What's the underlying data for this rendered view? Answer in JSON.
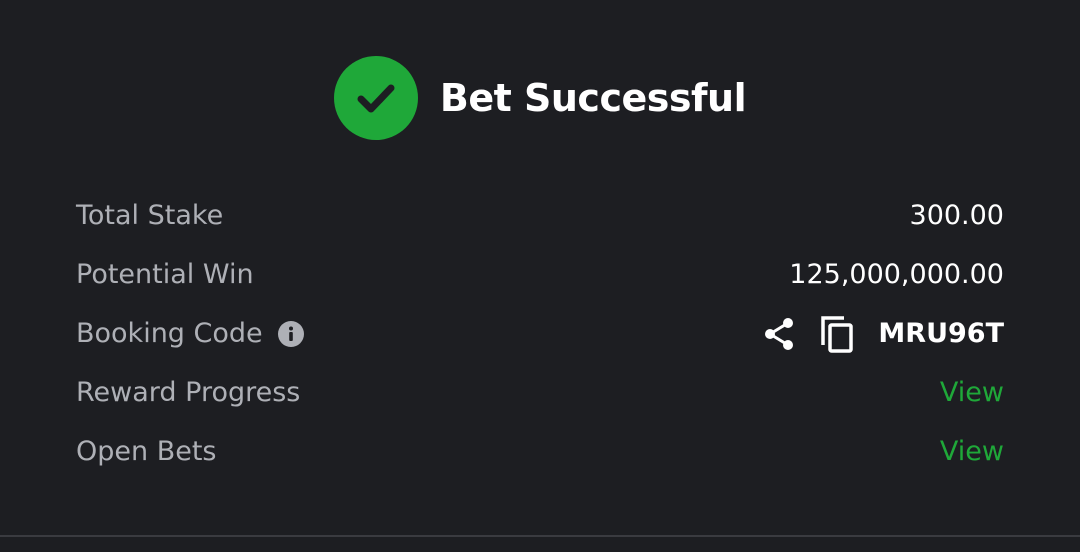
{
  "header": {
    "title": "Bet Successful",
    "icon": "check-circle-icon",
    "accent_color": "#1fa839"
  },
  "details": {
    "total_stake": {
      "label": "Total Stake",
      "value": "300.00"
    },
    "potential_win": {
      "label": "Potential Win",
      "value": "125,000,000.00"
    },
    "booking_code": {
      "label": "Booking Code",
      "value": "MRU96T",
      "icons": [
        "info-icon",
        "share-icon",
        "copy-icon"
      ]
    },
    "reward_progress": {
      "label": "Reward Progress",
      "action": "View"
    },
    "open_bets": {
      "label": "Open Bets",
      "action": "View"
    }
  },
  "colors": {
    "background": "#1d1e22",
    "label_text": "#aeb0b6",
    "value_text": "#ffffff",
    "link": "#1fa839"
  }
}
